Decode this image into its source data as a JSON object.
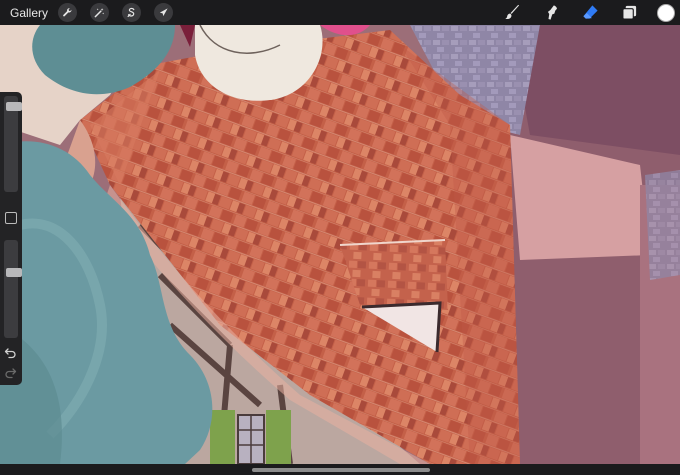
{
  "toolbar": {
    "gallery_label": "Gallery",
    "left_tools": [
      {
        "name": "actions-wrench-icon"
      },
      {
        "name": "adjustments-wand-icon"
      },
      {
        "name": "selection-s-icon"
      },
      {
        "name": "transform-arrow-icon"
      }
    ],
    "right_tools": [
      {
        "name": "brush-icon"
      },
      {
        "name": "smudge-icon"
      },
      {
        "name": "eraser-icon",
        "active": true
      },
      {
        "name": "layers-icon"
      }
    ],
    "current_color": "#ffffff",
    "accent_color": "#2f7bf5"
  },
  "sidebar": {
    "brush_size_level": 0.05,
    "opacity_level": 0.3,
    "undo_icon": "undo-arrow-icon",
    "redo_icon": "redo-arrow-icon"
  },
  "canvas": {
    "subject": "painting"
  }
}
